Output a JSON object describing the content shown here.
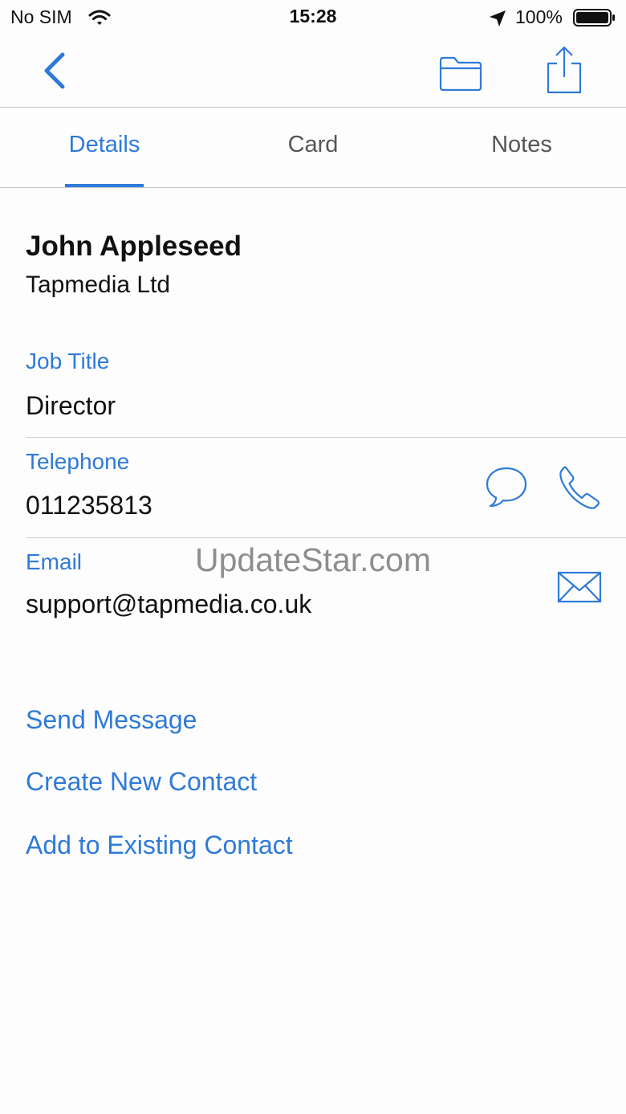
{
  "status_bar": {
    "carrier": "No SIM",
    "time": "15:28",
    "battery_percent": "100%",
    "icons": [
      "wifi-icon",
      "location-arrow-icon",
      "battery-full-icon"
    ]
  },
  "nav_bar": {
    "icons": [
      "chevron-left-icon",
      "folder-icon",
      "share-icon"
    ]
  },
  "tabs": [
    {
      "label": "Details",
      "active": true
    },
    {
      "label": "Card",
      "active": false
    },
    {
      "label": "Notes",
      "active": false
    }
  ],
  "contact": {
    "name": "John Appleseed",
    "company": "Tapmedia Ltd",
    "fields": [
      {
        "label": "Job Title",
        "value": "Director"
      },
      {
        "label": "Telephone",
        "value": "011235813",
        "actions": [
          "message-bubble-icon",
          "phone-icon"
        ]
      },
      {
        "label": "Email",
        "value": "support@tapmedia.co.uk",
        "actions": [
          "envelope-icon"
        ]
      }
    ]
  },
  "actions": [
    {
      "label": "Send Message"
    },
    {
      "label": "Create New Contact"
    },
    {
      "label": "Add to Existing Contact"
    }
  ],
  "watermark": "UpdateStar.com",
  "colors": {
    "accent": "#2f7ad8",
    "text": "#111111",
    "secondary_text": "#555555",
    "divider": "#d0d0d4",
    "background": "#fdfdfd"
  }
}
